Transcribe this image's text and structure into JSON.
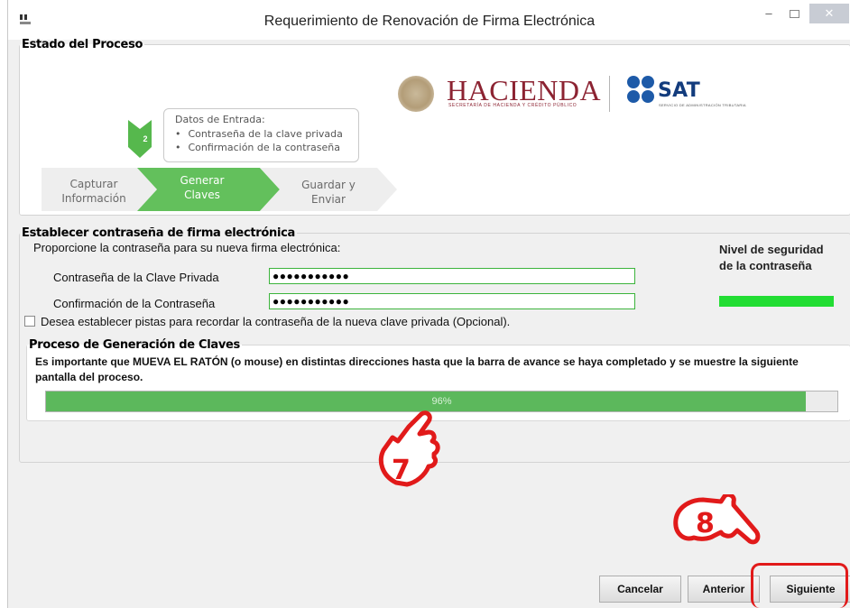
{
  "window": {
    "title": "Requerimiento de Renovación de Firma Electrónica",
    "icon_text": "SAT",
    "controls": [
      "minimize",
      "maximize",
      "close"
    ]
  },
  "estado": {
    "legend": "Estado del Proceso",
    "logos": {
      "hacienda": "HACIENDA",
      "hacienda_sub": "SECRETARÍA DE HACIENDA Y CRÉDITO PÚBLICO",
      "sat": "SAT",
      "sat_sub": "SERVICIO DE ADMINISTRACIÓN TRIBUTARIA"
    },
    "step_number": "2",
    "info": {
      "header": "Datos de Entrada:",
      "items": [
        "Contraseña de la clave privada",
        "Confirmación de la contraseña"
      ]
    },
    "steps": [
      {
        "line1": "Capturar",
        "line2": "Información",
        "state": "done"
      },
      {
        "line1": "Generar",
        "line2": "Claves",
        "state": "active"
      },
      {
        "line1": "Guardar y",
        "line2": "Enviar",
        "state": "pending"
      }
    ]
  },
  "clave": {
    "legend": "Establecer contraseña de firma electrónica",
    "prompt": "Proporcione la contraseña para su nueva firma electrónica:",
    "password_label": "Contraseña de la Clave Privada",
    "password_value": "●●●●●●●●●●●",
    "confirm_label": "Confirmación de la Contraseña",
    "confirm_value": "●●●●●●●●●●●",
    "nivel_line1": "Nivel de seguridad",
    "nivel_line2": "de la contraseña",
    "strength": 1.0,
    "hint_checkbox_label": "Desea establecer pistas para recordar la contraseña de la nueva clave privada (Opcional).",
    "hint_checked": false
  },
  "proceso": {
    "legend": "Proceso de Generación de Claves",
    "instructions": "Es importante que MUEVA EL RATÓN (o mouse) en distintas direcciones hasta que la barra de avance se haya completado y se muestre la siguiente pantalla del proceso.",
    "progress": 96,
    "progress_label": "96%"
  },
  "buttons": {
    "cancel": "Cancelar",
    "previous": "Anterior",
    "next": "Siguiente"
  },
  "annotations": {
    "mark_7": "7",
    "mark_8": "8"
  },
  "colors": {
    "accent_green": "#5cb85c",
    "step_active": "#63c05c",
    "step_done_badge": "#56b84d",
    "hacienda": "#8c2332",
    "sat_blue": "#1d5aa8",
    "annotation_red": "#e11a1a",
    "strength_green": "#22dd33"
  }
}
